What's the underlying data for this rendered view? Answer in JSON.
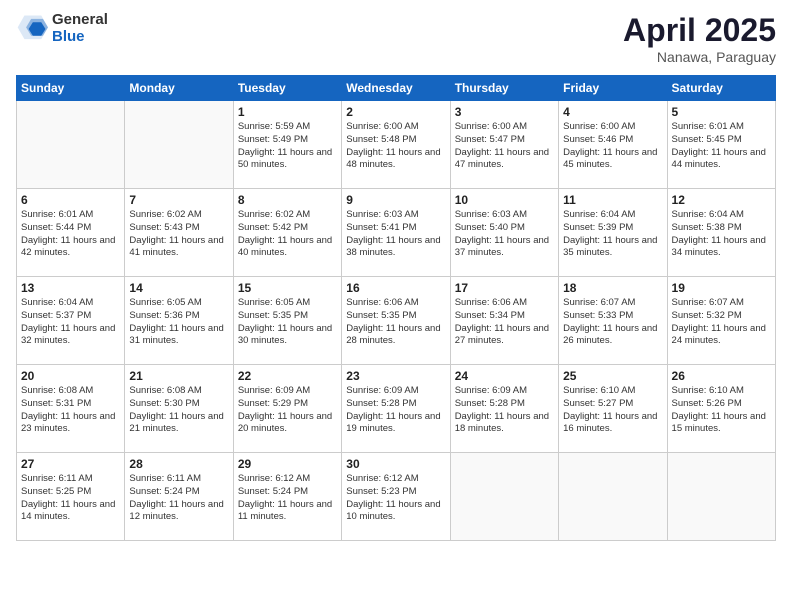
{
  "header": {
    "logo_general": "General",
    "logo_blue": "Blue",
    "month": "April 2025",
    "location": "Nanawa, Paraguay"
  },
  "weekdays": [
    "Sunday",
    "Monday",
    "Tuesday",
    "Wednesday",
    "Thursday",
    "Friday",
    "Saturday"
  ],
  "weeks": [
    [
      {
        "day": "",
        "empty": true
      },
      {
        "day": "",
        "empty": true
      },
      {
        "day": "1",
        "sunrise": "Sunrise: 5:59 AM",
        "sunset": "Sunset: 5:49 PM",
        "daylight": "Daylight: 11 hours and 50 minutes."
      },
      {
        "day": "2",
        "sunrise": "Sunrise: 6:00 AM",
        "sunset": "Sunset: 5:48 PM",
        "daylight": "Daylight: 11 hours and 48 minutes."
      },
      {
        "day": "3",
        "sunrise": "Sunrise: 6:00 AM",
        "sunset": "Sunset: 5:47 PM",
        "daylight": "Daylight: 11 hours and 47 minutes."
      },
      {
        "day": "4",
        "sunrise": "Sunrise: 6:00 AM",
        "sunset": "Sunset: 5:46 PM",
        "daylight": "Daylight: 11 hours and 45 minutes."
      },
      {
        "day": "5",
        "sunrise": "Sunrise: 6:01 AM",
        "sunset": "Sunset: 5:45 PM",
        "daylight": "Daylight: 11 hours and 44 minutes."
      }
    ],
    [
      {
        "day": "6",
        "sunrise": "Sunrise: 6:01 AM",
        "sunset": "Sunset: 5:44 PM",
        "daylight": "Daylight: 11 hours and 42 minutes."
      },
      {
        "day": "7",
        "sunrise": "Sunrise: 6:02 AM",
        "sunset": "Sunset: 5:43 PM",
        "daylight": "Daylight: 11 hours and 41 minutes."
      },
      {
        "day": "8",
        "sunrise": "Sunrise: 6:02 AM",
        "sunset": "Sunset: 5:42 PM",
        "daylight": "Daylight: 11 hours and 40 minutes."
      },
      {
        "day": "9",
        "sunrise": "Sunrise: 6:03 AM",
        "sunset": "Sunset: 5:41 PM",
        "daylight": "Daylight: 11 hours and 38 minutes."
      },
      {
        "day": "10",
        "sunrise": "Sunrise: 6:03 AM",
        "sunset": "Sunset: 5:40 PM",
        "daylight": "Daylight: 11 hours and 37 minutes."
      },
      {
        "day": "11",
        "sunrise": "Sunrise: 6:04 AM",
        "sunset": "Sunset: 5:39 PM",
        "daylight": "Daylight: 11 hours and 35 minutes."
      },
      {
        "day": "12",
        "sunrise": "Sunrise: 6:04 AM",
        "sunset": "Sunset: 5:38 PM",
        "daylight": "Daylight: 11 hours and 34 minutes."
      }
    ],
    [
      {
        "day": "13",
        "sunrise": "Sunrise: 6:04 AM",
        "sunset": "Sunset: 5:37 PM",
        "daylight": "Daylight: 11 hours and 32 minutes."
      },
      {
        "day": "14",
        "sunrise": "Sunrise: 6:05 AM",
        "sunset": "Sunset: 5:36 PM",
        "daylight": "Daylight: 11 hours and 31 minutes."
      },
      {
        "day": "15",
        "sunrise": "Sunrise: 6:05 AM",
        "sunset": "Sunset: 5:35 PM",
        "daylight": "Daylight: 11 hours and 30 minutes."
      },
      {
        "day": "16",
        "sunrise": "Sunrise: 6:06 AM",
        "sunset": "Sunset: 5:35 PM",
        "daylight": "Daylight: 11 hours and 28 minutes."
      },
      {
        "day": "17",
        "sunrise": "Sunrise: 6:06 AM",
        "sunset": "Sunset: 5:34 PM",
        "daylight": "Daylight: 11 hours and 27 minutes."
      },
      {
        "day": "18",
        "sunrise": "Sunrise: 6:07 AM",
        "sunset": "Sunset: 5:33 PM",
        "daylight": "Daylight: 11 hours and 26 minutes."
      },
      {
        "day": "19",
        "sunrise": "Sunrise: 6:07 AM",
        "sunset": "Sunset: 5:32 PM",
        "daylight": "Daylight: 11 hours and 24 minutes."
      }
    ],
    [
      {
        "day": "20",
        "sunrise": "Sunrise: 6:08 AM",
        "sunset": "Sunset: 5:31 PM",
        "daylight": "Daylight: 11 hours and 23 minutes."
      },
      {
        "day": "21",
        "sunrise": "Sunrise: 6:08 AM",
        "sunset": "Sunset: 5:30 PM",
        "daylight": "Daylight: 11 hours and 21 minutes."
      },
      {
        "day": "22",
        "sunrise": "Sunrise: 6:09 AM",
        "sunset": "Sunset: 5:29 PM",
        "daylight": "Daylight: 11 hours and 20 minutes."
      },
      {
        "day": "23",
        "sunrise": "Sunrise: 6:09 AM",
        "sunset": "Sunset: 5:28 PM",
        "daylight": "Daylight: 11 hours and 19 minutes."
      },
      {
        "day": "24",
        "sunrise": "Sunrise: 6:09 AM",
        "sunset": "Sunset: 5:28 PM",
        "daylight": "Daylight: 11 hours and 18 minutes."
      },
      {
        "day": "25",
        "sunrise": "Sunrise: 6:10 AM",
        "sunset": "Sunset: 5:27 PM",
        "daylight": "Daylight: 11 hours and 16 minutes."
      },
      {
        "day": "26",
        "sunrise": "Sunrise: 6:10 AM",
        "sunset": "Sunset: 5:26 PM",
        "daylight": "Daylight: 11 hours and 15 minutes."
      }
    ],
    [
      {
        "day": "27",
        "sunrise": "Sunrise: 6:11 AM",
        "sunset": "Sunset: 5:25 PM",
        "daylight": "Daylight: 11 hours and 14 minutes."
      },
      {
        "day": "28",
        "sunrise": "Sunrise: 6:11 AM",
        "sunset": "Sunset: 5:24 PM",
        "daylight": "Daylight: 11 hours and 12 minutes."
      },
      {
        "day": "29",
        "sunrise": "Sunrise: 6:12 AM",
        "sunset": "Sunset: 5:24 PM",
        "daylight": "Daylight: 11 hours and 11 minutes."
      },
      {
        "day": "30",
        "sunrise": "Sunrise: 6:12 AM",
        "sunset": "Sunset: 5:23 PM",
        "daylight": "Daylight: 11 hours and 10 minutes."
      },
      {
        "day": "",
        "empty": true
      },
      {
        "day": "",
        "empty": true
      },
      {
        "day": "",
        "empty": true
      }
    ]
  ]
}
